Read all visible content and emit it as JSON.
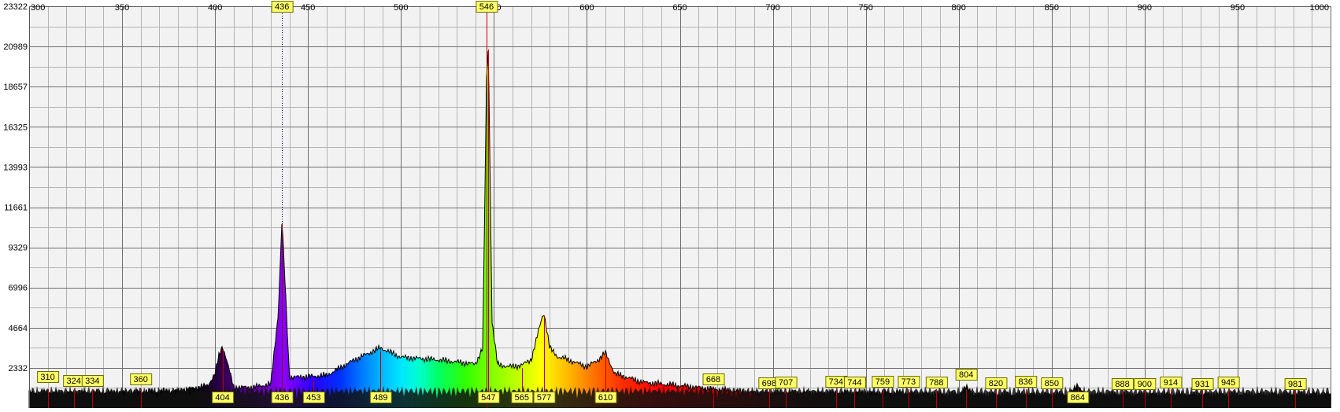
{
  "chart_data": {
    "type": "area",
    "title": "",
    "xlabel": "",
    "ylabel": "",
    "xlim": [
      300,
      1000
    ],
    "ylim": [
      0,
      23322
    ],
    "x_ticks": [
      300,
      350,
      400,
      450,
      500,
      550,
      600,
      650,
      700,
      750,
      800,
      850,
      900,
      950,
      1000
    ],
    "y_ticks": [
      2332,
      4664,
      6996,
      9329,
      11661,
      13993,
      16325,
      18657,
      20989,
      23322
    ],
    "grid": true,
    "cursor_markers": [
      436,
      546
    ],
    "series": [
      {
        "name": "",
        "x": [
          300,
          340,
          380,
          396,
          400,
          402,
          404,
          406,
          410,
          420,
          430,
          434,
          436,
          438,
          440,
          445,
          453,
          460,
          475,
          489,
          500,
          520,
          540,
          544,
          546,
          547,
          549,
          552,
          560,
          565,
          570,
          576,
          577,
          580,
          584,
          590,
          600,
          606,
          610,
          615,
          630,
          650,
          668,
          690,
          720,
          760,
          800,
          804,
          808,
          840,
          860,
          864,
          868,
          900,
          960,
          1000
        ],
        "y": [
          900,
          900,
          1000,
          1300,
          2000,
          3000,
          3600,
          2900,
          1200,
          1200,
          1400,
          5500,
          10900,
          6500,
          1800,
          1800,
          1850,
          1900,
          2800,
          3500,
          2950,
          2800,
          2550,
          3500,
          19000,
          21000,
          5000,
          2500,
          2400,
          2500,
          2800,
          5300,
          5500,
          3500,
          3000,
          2800,
          2400,
          2800,
          3200,
          2000,
          1500,
          1300,
          1100,
          900,
          900,
          900,
          800,
          1200,
          800,
          800,
          800,
          1350,
          800,
          800,
          800,
          800
        ]
      }
    ],
    "peak_labels_bottom": [
      404,
      436,
      453,
      489,
      547,
      565,
      577,
      610,
      864
    ],
    "peak_labels_top": [
      310,
      324,
      334,
      360,
      668,
      698,
      707,
      734,
      744,
      759,
      773,
      788,
      804,
      820,
      836,
      850,
      888,
      900,
      914,
      931,
      945,
      981
    ],
    "colors": {
      "background": "#ffffff",
      "plot_background": "#f2f2f2",
      "grid_major": "#6e6e6e",
      "grid_minor": "#b4b4b4",
      "label_fill": "#ffff66",
      "label_border": "#6b6b00",
      "marker_line": "#c00000",
      "baseline_fill": "#111111"
    }
  }
}
